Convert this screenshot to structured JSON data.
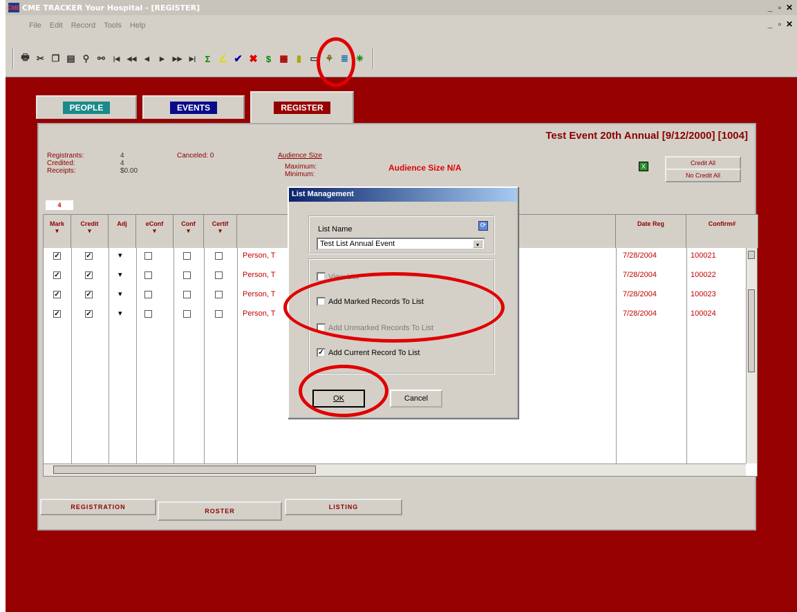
{
  "window": {
    "title": "CME TRACKER  Your Hospital - [REGISTER]",
    "controls": [
      "_",
      "×"
    ]
  },
  "menu": [
    "File",
    "Edit",
    "Record",
    "Tools",
    "Help"
  ],
  "toolbar_icons": [
    "print",
    "cut",
    "copy",
    "paste",
    "find",
    "find-replace",
    "first",
    "prev-page",
    "prev",
    "next",
    "next-page",
    "last",
    "sigma",
    "list",
    "check",
    "delete",
    "dollar",
    "calc",
    "doc",
    "card",
    "tree",
    "bar",
    "cross"
  ],
  "tabs": {
    "people": "PEOPLE",
    "events": "EVENTS",
    "register": "REGISTER"
  },
  "event": {
    "title": "Test Event 20th Annual [9/12/2000] [1004]"
  },
  "summary": {
    "registrants_label": "Registrants:",
    "registrants": "4",
    "credited_label": "Credited:",
    "credited": "4",
    "receipts_label": "Receipts:",
    "receipts": "$0.00",
    "canceled": "Canceled: 0",
    "audience_link": "Audience Size",
    "maximum": "Maximum:",
    "minimum": "Minimum:",
    "audience_na": "Audience Size N/A",
    "count_badge": "4"
  },
  "buttons": {
    "credit_all": "Credit All",
    "no_credit_all": "No Credit All"
  },
  "columns": {
    "mark": "Mark",
    "credit": "Credit",
    "adj": "Adj",
    "econf": "eConf",
    "conf": "Conf",
    "certif": "Certif",
    "date_reg": "Date Reg",
    "confirm": "Confirm#"
  },
  "rows": [
    {
      "name": "Person, T",
      "date": "7/28/2004",
      "confirm": "100021"
    },
    {
      "name": "Person, T",
      "date": "7/28/2004",
      "confirm": "100022"
    },
    {
      "name": "Person, T",
      "date": "7/28/2004",
      "confirm": "100023"
    },
    {
      "name": "Person, T",
      "date": "7/28/2004",
      "confirm": "100024"
    }
  ],
  "bottom_tabs": {
    "registration": "REGISTRATION",
    "roster": "ROSTER",
    "listing": "LISTING"
  },
  "dialog": {
    "title": "List Management",
    "list_name_label": "List Name",
    "list_name_value": "Test List Annual Event",
    "view_list": "View List",
    "add_marked": "Add Marked Records To List",
    "add_unmarked": "Add Unmarked Records To List",
    "add_current": "Add Current Record To List",
    "ok": "OK",
    "cancel": "Cancel"
  },
  "colors": {
    "background": "#970000",
    "panel": "#d4d0c8",
    "accent_red": "#8b0000",
    "highlight_ring": "#e00000"
  }
}
